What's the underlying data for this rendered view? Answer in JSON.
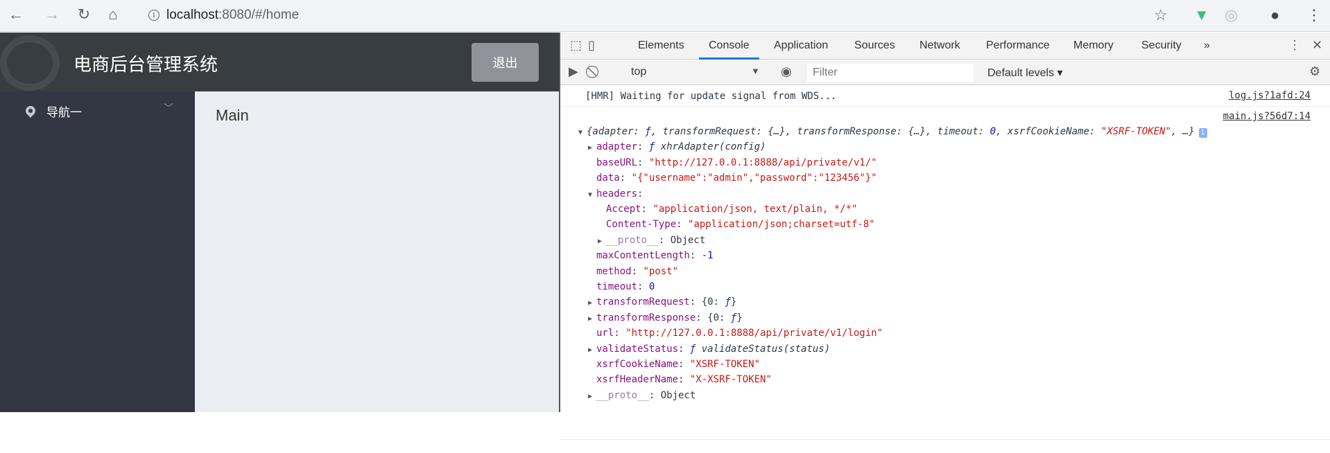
{
  "browser": {
    "url_host": "localhost",
    "url_rest": ":8080/#/home",
    "icons": [
      "back-icon",
      "forward-icon",
      "reload-icon",
      "home-icon",
      "info-icon",
      "star-icon",
      "vue-devtools-icon",
      "extension-icon",
      "profile-icon",
      "menu-icon"
    ]
  },
  "app": {
    "title": "电商后台管理系统",
    "logout_label": "退出",
    "sidebar": {
      "items": [
        {
          "label": "导航一"
        }
      ]
    },
    "main_text": "Main",
    "colors": {
      "header": "#373d41",
      "sidebar": "#333744",
      "main": "#eaedf1",
      "button": "#909399"
    }
  },
  "devtools": {
    "tabs": [
      "Elements",
      "Console",
      "Application",
      "Sources",
      "Network",
      "Performance",
      "Memory",
      "Security"
    ],
    "active_tab": "Console",
    "more": "»",
    "context": "top",
    "filter_placeholder": "Filter",
    "levels": "Default levels ▾",
    "messages": [
      {
        "text": "[HMR] Waiting for update signal from WDS...",
        "source": "log.js?1afd:24"
      },
      {
        "source": "main.js?56d7:14"
      }
    ],
    "lines": [
      {
        "indent": 0,
        "arrow": "▼",
        "parts": [
          [
            "{adapter: ",
            "i p"
          ],
          [
            "ƒ",
            "fk"
          ],
          [
            ", transformRequest: {…}, transformResponse: {…}, timeout: ",
            "i p"
          ],
          [
            "0",
            "i n"
          ],
          [
            ", xsrfCookieName: ",
            "i p"
          ],
          [
            "\"XSRF-TOKEN\"",
            "i s"
          ],
          [
            ", …}",
            "i p"
          ]
        ]
      },
      {
        "indent": 1,
        "arrow": "▶",
        "parts": [
          [
            "adapter",
            "k"
          ],
          [
            ": ",
            "p"
          ],
          [
            "ƒ ",
            "fk"
          ],
          [
            "xhrAdapter(config)",
            "i p"
          ]
        ]
      },
      {
        "indent": 1,
        "arrow": "",
        "parts": [
          [
            "baseURL",
            "k"
          ],
          [
            ": ",
            "p"
          ],
          [
            "\"http://127.0.0.1:8888/api/private/v1/\"",
            "s"
          ]
        ]
      },
      {
        "indent": 1,
        "arrow": "",
        "parts": [
          [
            "data",
            "k"
          ],
          [
            ": ",
            "p"
          ],
          [
            "\"{\"username\":\"admin\",\"password\":\"123456\"}\"",
            "s"
          ]
        ]
      },
      {
        "indent": 1,
        "arrow": "▼",
        "parts": [
          [
            "headers",
            "k"
          ],
          [
            ":",
            "p"
          ]
        ]
      },
      {
        "indent": 2,
        "arrow": "",
        "parts": [
          [
            "Accept",
            "k"
          ],
          [
            ": ",
            "p"
          ],
          [
            "\"application/json, text/plain, */*\"",
            "s"
          ]
        ]
      },
      {
        "indent": 2,
        "arrow": "",
        "parts": [
          [
            "Content-Type",
            "k"
          ],
          [
            ": ",
            "p"
          ],
          [
            "\"application/json;charset=utf-8\"",
            "s"
          ]
        ]
      },
      {
        "indent": 2,
        "arrow": "▶",
        "parts": [
          [
            "__proto__",
            "dim"
          ],
          [
            ": Object",
            "p"
          ]
        ]
      },
      {
        "indent": 1,
        "arrow": "",
        "parts": [
          [
            "maxContentLength",
            "k"
          ],
          [
            ": ",
            "p"
          ],
          [
            "-1",
            "n"
          ]
        ]
      },
      {
        "indent": 1,
        "arrow": "",
        "parts": [
          [
            "method",
            "k"
          ],
          [
            ": ",
            "p"
          ],
          [
            "\"post\"",
            "s"
          ]
        ]
      },
      {
        "indent": 1,
        "arrow": "",
        "parts": [
          [
            "timeout",
            "k"
          ],
          [
            ": ",
            "p"
          ],
          [
            "0",
            "n"
          ]
        ]
      },
      {
        "indent": 1,
        "arrow": "▶",
        "parts": [
          [
            "transformRequest",
            "k"
          ],
          [
            ": {0: ",
            "p"
          ],
          [
            "ƒ",
            "fk"
          ],
          [
            "}",
            "p"
          ]
        ]
      },
      {
        "indent": 1,
        "arrow": "▶",
        "parts": [
          [
            "transformResponse",
            "k"
          ],
          [
            ": {0: ",
            "p"
          ],
          [
            "ƒ",
            "fk"
          ],
          [
            "}",
            "p"
          ]
        ]
      },
      {
        "indent": 1,
        "arrow": "",
        "parts": [
          [
            "url",
            "k"
          ],
          [
            ": ",
            "p"
          ],
          [
            "\"http://127.0.0.1:8888/api/private/v1/login\"",
            "s"
          ]
        ]
      },
      {
        "indent": 1,
        "arrow": "▶",
        "parts": [
          [
            "validateStatus",
            "k"
          ],
          [
            ": ",
            "p"
          ],
          [
            "ƒ ",
            "fk"
          ],
          [
            "validateStatus(status)",
            "i p"
          ]
        ]
      },
      {
        "indent": 1,
        "arrow": "",
        "parts": [
          [
            "xsrfCookieName",
            "k"
          ],
          [
            ": ",
            "p"
          ],
          [
            "\"XSRF-TOKEN\"",
            "s"
          ]
        ]
      },
      {
        "indent": 1,
        "arrow": "",
        "parts": [
          [
            "xsrfHeaderName",
            "k"
          ],
          [
            ": ",
            "p"
          ],
          [
            "\"X-XSRF-TOKEN\"",
            "s"
          ]
        ]
      },
      {
        "indent": 1,
        "arrow": "▶",
        "parts": [
          [
            "__proto__",
            "dim"
          ],
          [
            ": Object",
            "p"
          ]
        ]
      }
    ]
  }
}
